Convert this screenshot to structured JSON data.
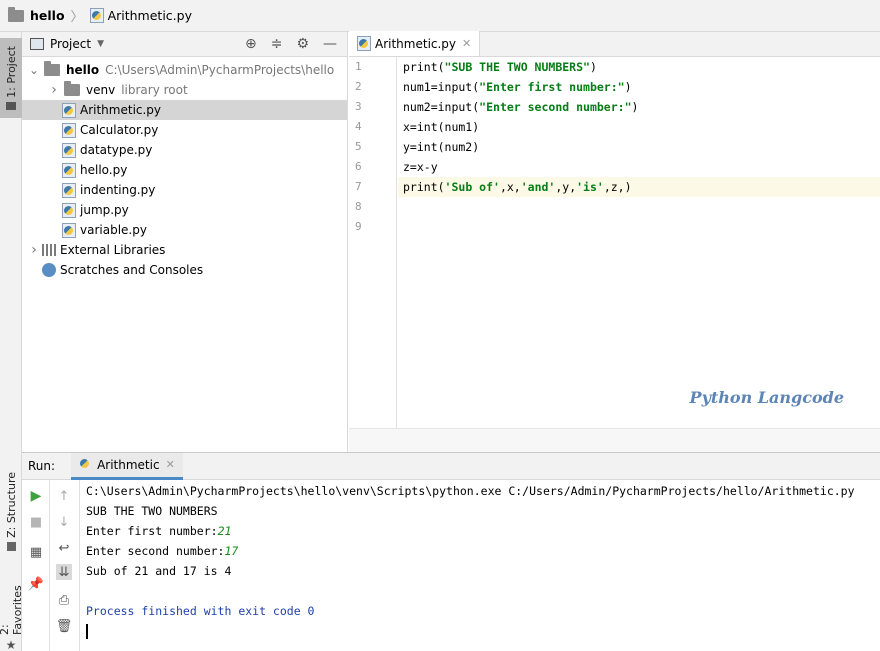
{
  "breadcrumb": {
    "project": "hello",
    "file": "Arithmetic.py"
  },
  "left_stripe": {
    "project_tab": "1: Project",
    "structure_tab": "Z: Structure",
    "favorites_tab": "2: Favorites"
  },
  "project_panel": {
    "title": "Project",
    "tree": [
      {
        "label": "hello",
        "hint": "C:\\Users\\Admin\\PycharmProjects\\hello",
        "type": "folder",
        "expanded": true,
        "level": 0
      },
      {
        "label": "venv",
        "hint": "library root",
        "type": "folder",
        "expanded": false,
        "level": 1
      },
      {
        "label": "Arithmetic.py",
        "type": "py",
        "level": 1,
        "selected": true
      },
      {
        "label": "Calculator.py",
        "type": "py",
        "level": 1
      },
      {
        "label": "datatype.py",
        "type": "py",
        "level": 1
      },
      {
        "label": "hello.py",
        "type": "py",
        "level": 1
      },
      {
        "label": "indenting.py",
        "type": "py",
        "level": 1
      },
      {
        "label": "jump.py",
        "type": "py",
        "level": 1
      },
      {
        "label": "variable.py",
        "type": "py",
        "level": 1
      },
      {
        "label": "External Libraries",
        "type": "lib",
        "level": 0
      },
      {
        "label": "Scratches and Consoles",
        "type": "scratch",
        "level": 0
      }
    ]
  },
  "editor": {
    "tab": "Arithmetic.py",
    "line_numbers": [
      "1",
      "2",
      "3",
      "4",
      "5",
      "6",
      "7",
      "8",
      "9"
    ],
    "lines": [
      {
        "pre": "print(",
        "str": "\"SUB THE TWO NUMBERS\"",
        "post": ")"
      },
      {
        "pre": "num1=input(",
        "str": "\"Enter first number:\"",
        "post": ")"
      },
      {
        "pre": "num2=input(",
        "str": "\"Enter second number:\"",
        "post": ")"
      },
      {
        "pre": "x=int(num1)",
        "str": "",
        "post": ""
      },
      {
        "pre": "y=int(num2)",
        "str": "",
        "post": ""
      },
      {
        "pre": "z=x-y",
        "str": "",
        "post": ""
      },
      {
        "pre": "print(",
        "str": "'Sub of'",
        "post": ",x,",
        "str2": "'and'",
        "post2": ",y,",
        "str3": "'is'",
        "post3": ",z,)"
      },
      {
        "pre": "",
        "str": "",
        "post": ""
      },
      {
        "pre": "",
        "str": "",
        "post": ""
      }
    ],
    "current_line": 7,
    "watermark": "Python Langcode"
  },
  "run": {
    "label": "Run:",
    "tab": "Arithmetic",
    "console": {
      "command": "C:\\Users\\Admin\\PycharmProjects\\hello\\venv\\Scripts\\python.exe C:/Users/Admin/PycharmProjects/hello/Arithmetic.py",
      "line1": "SUB THE TWO NUMBERS",
      "prompt1": "Enter first number:",
      "input1": "21",
      "prompt2": "Enter second number:",
      "input2": "17",
      "result": "Sub of 21 and 17 is 4",
      "exit": "Process finished with exit code 0"
    }
  },
  "colors": {
    "string": "#067d17",
    "exit": "#1f3fa8",
    "input": "#1a8a1a",
    "watermark": "#5d85b6",
    "selection": "#d5d5d5",
    "accent": "#4a88c7"
  }
}
